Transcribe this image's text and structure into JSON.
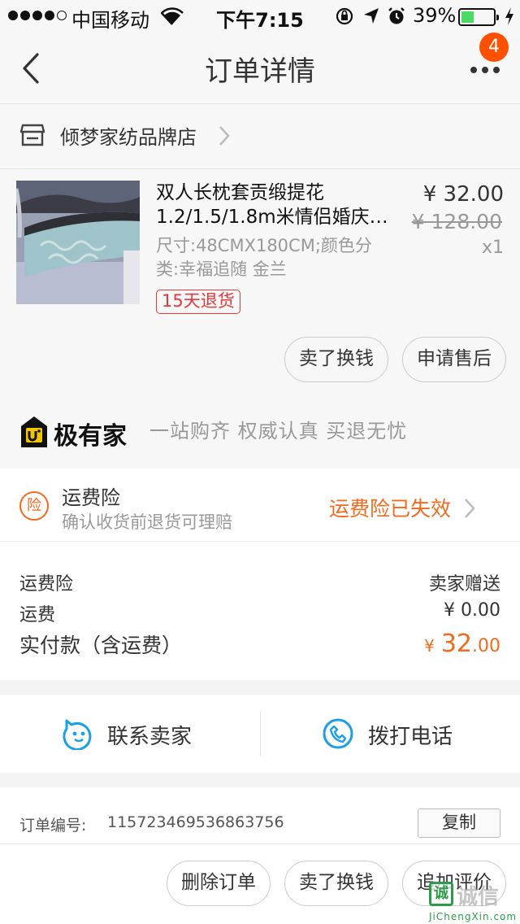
{
  "status_bar": {
    "carrier": "中国移动",
    "time": "下午7:15",
    "battery": "39%",
    "battery_level": 0.39
  },
  "nav": {
    "title": "订单详情",
    "badge_count": "4"
  },
  "store": {
    "name": "倾梦家纺品牌店"
  },
  "product": {
    "name_line1": "双人长枕套贡缎提花",
    "name_line2": "1.2/1.5/1.8m米情侣婚庆…",
    "price": "¥ 32.00",
    "original_price": "¥ 128.00",
    "quantity": "x1",
    "spec_line1": "尺寸:48CMX180CM;颜色分",
    "spec_line2": "类:幸福追随 金兰",
    "return_tag": "15天退货",
    "sell_button": "卖了换钱",
    "after_sale_button": "申请售后"
  },
  "brand": {
    "name": "极有家",
    "slogan": "一站购齐 权威认真 买退无忧"
  },
  "insurance": {
    "icon_char": "险",
    "title": "运费险",
    "subtitle": "确认收货前退货可理赔",
    "status": "运费险已失效"
  },
  "summary": {
    "insurance_label": "运费险",
    "insurance_value": "卖家赠送",
    "shipping_label": "运费",
    "shipping_value": "¥ 0.00",
    "paid_label": "实付款（含运费）",
    "paid_currency": "¥",
    "paid_integer": "32",
    "paid_decimal": ".00"
  },
  "contact": {
    "seller_label": "联系卖家",
    "phone_label": "拨打电话"
  },
  "order": {
    "number_label": "订单编号:",
    "number": "115723469536863756",
    "copy_button": "复制"
  },
  "actions": {
    "delete": "删除订单",
    "sell": "卖了换钱",
    "review": "追加评价"
  },
  "watermark": {
    "glyph": "诚",
    "text": "诚信",
    "url": "JiChengXin.com"
  },
  "colors": {
    "accent": "#f16a1d",
    "badge": "#ff5000",
    "tag_red": "#e4393c",
    "contact_blue": "#1aa0e8"
  },
  "icons": [
    "back-chevron-icon",
    "more-dots-icon",
    "store-icon",
    "chevron-right-icon",
    "brand-logo-icon",
    "insurance-icon",
    "smile-chat-icon",
    "phone-icon"
  ]
}
